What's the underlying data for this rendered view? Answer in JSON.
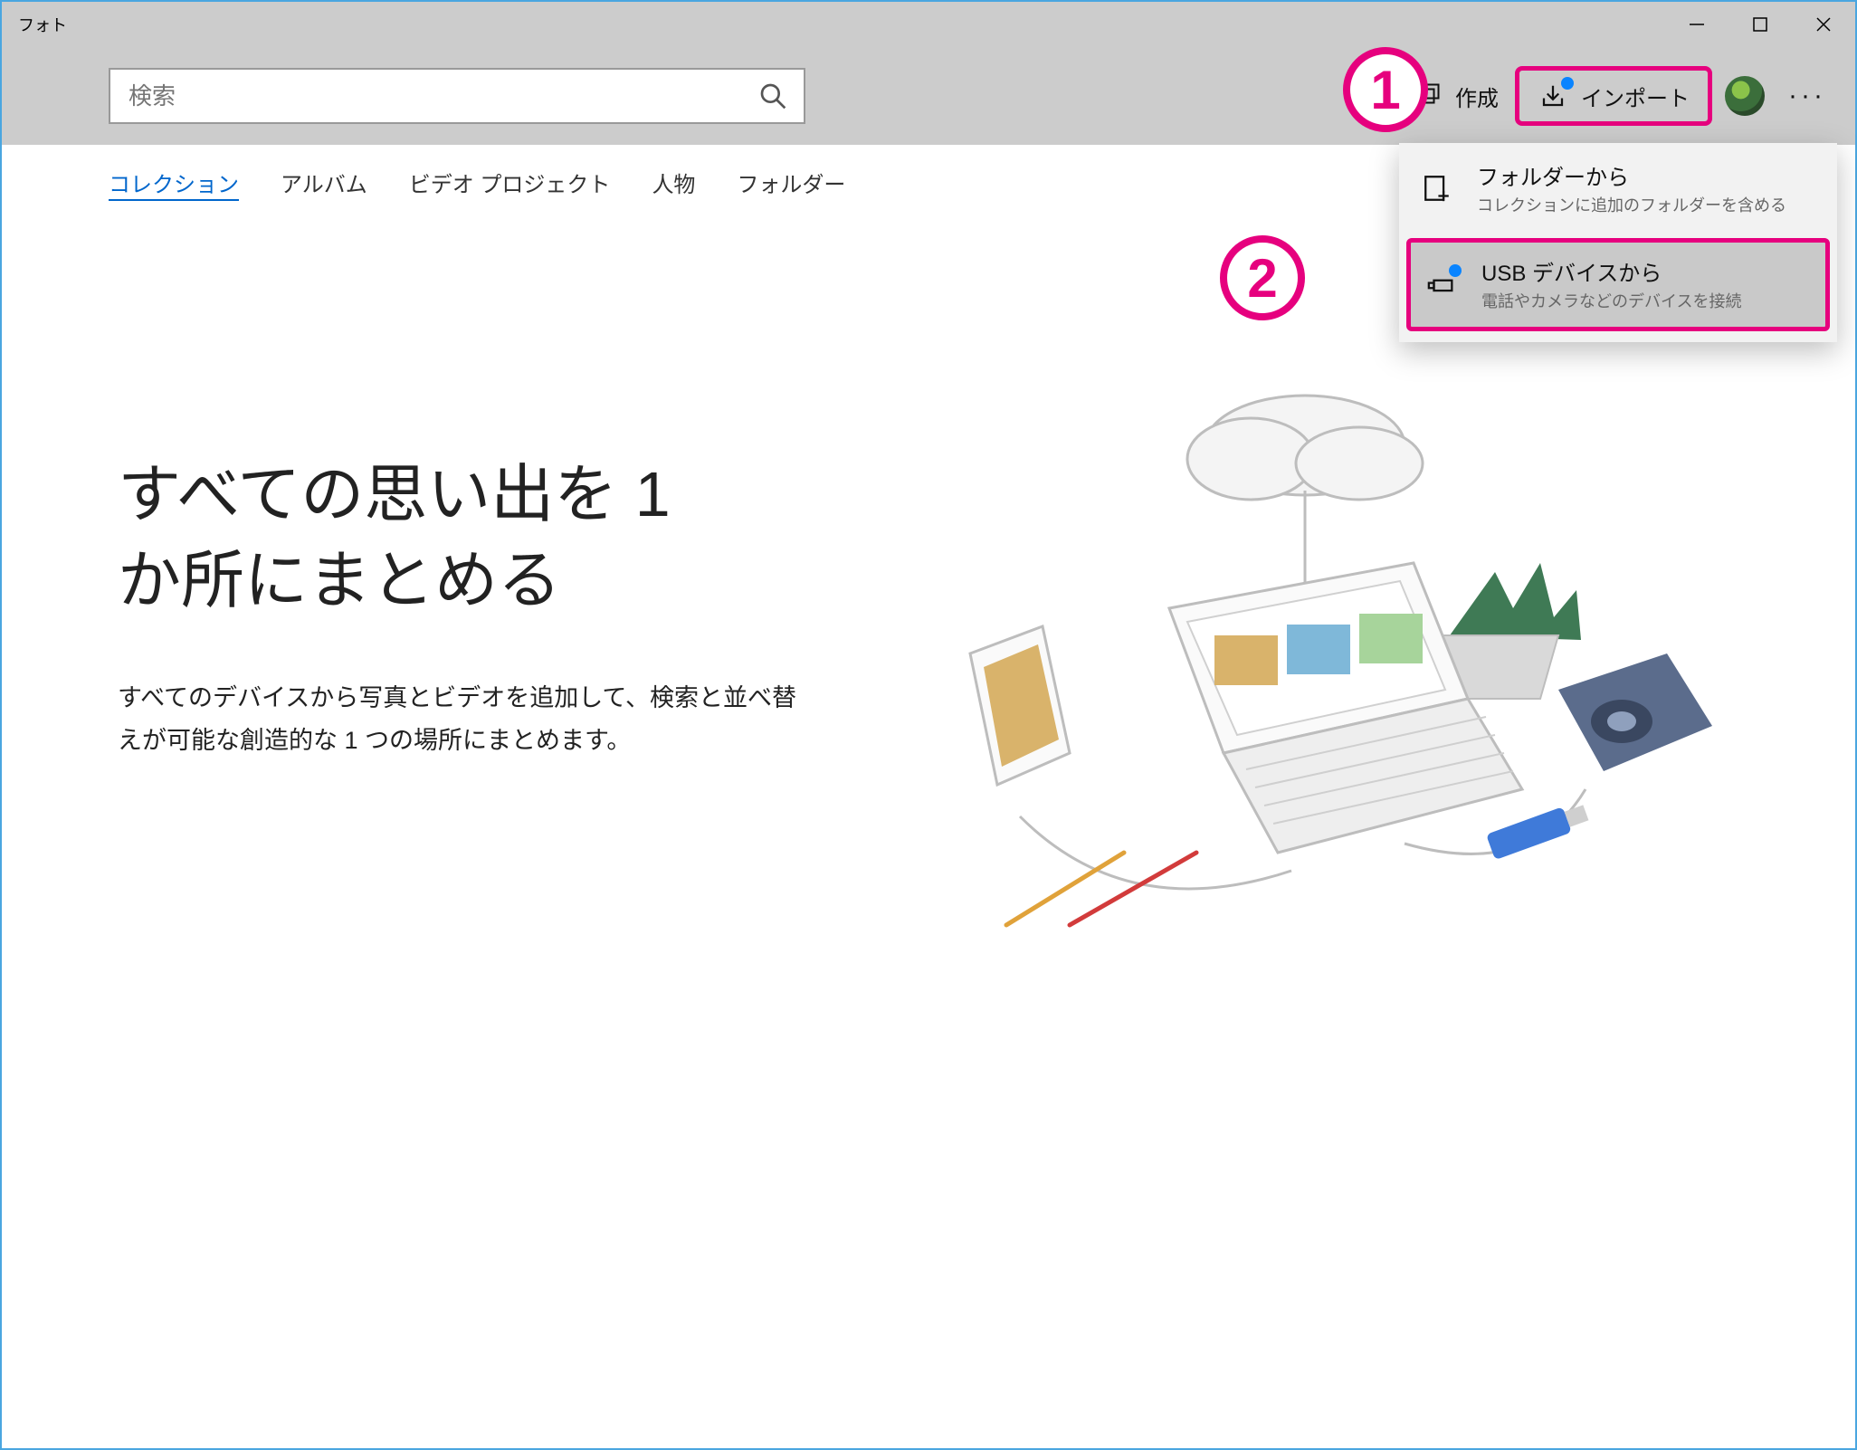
{
  "colors": {
    "highlight": "#e6007e",
    "link": "#0066cc"
  },
  "titlebar": {
    "app_name": "フォト"
  },
  "cmdbar": {
    "search_placeholder": "検索",
    "create_label": "作成",
    "import_label": "インポート"
  },
  "tabs": [
    {
      "label": "コレクション",
      "active": true
    },
    {
      "label": "アルバム",
      "active": false
    },
    {
      "label": "ビデオ プロジェクト",
      "active": false
    },
    {
      "label": "人物",
      "active": false
    },
    {
      "label": "フォルダー",
      "active": false
    }
  ],
  "hero": {
    "heading_l1": "すべての思い出を 1",
    "heading_l2": "か所にまとめる",
    "body": "すべてのデバイスから写真とビデオを追加して、検索と並べ替えが可能な創造的な 1 つの場所にまとめます。"
  },
  "import_menu": {
    "from_folder": {
      "title": "フォルダーから",
      "sub": "コレクションに追加のフォルダーを含める"
    },
    "from_usb": {
      "title": "USB デバイスから",
      "sub": "電話やカメラなどのデバイスを接続"
    }
  },
  "annotations": {
    "one": "1",
    "two": "2"
  }
}
